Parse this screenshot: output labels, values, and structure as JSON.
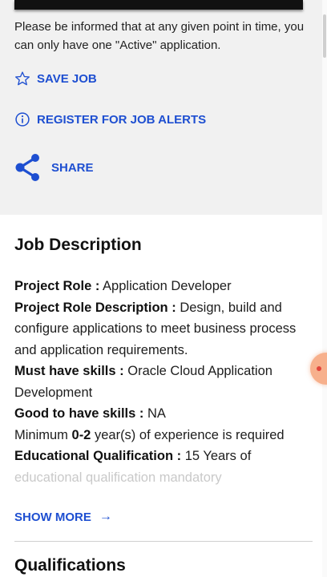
{
  "notice": {
    "text": "Please be informed that at any given point in time, you can only have one \"Active\" application."
  },
  "actions": {
    "save_job": "SAVE JOB",
    "job_alerts": "REGISTER FOR JOB ALERTS",
    "share": "SHARE"
  },
  "job_description": {
    "title": "Job Description",
    "project_role_label": "Project Role :",
    "project_role_value": "Application Developer",
    "role_description_label": "Project Role Description :",
    "role_description_value": "Design, build and configure applications to meet business process and application requirements.",
    "must_have_label": "Must have skills :",
    "must_have_value": "Oracle Cloud Application Development",
    "good_to_have_label": "Good to have skills :",
    "good_to_have_value": "NA",
    "experience_prefix": "Minimum",
    "experience_years": "0-2",
    "experience_suffix": "year(s) of experience is required",
    "education_label": "Educational Qualification :",
    "education_value": "15 Years of",
    "education_faded": "educational qualification mandatory"
  },
  "show_more": {
    "label": "SHOW MORE",
    "arrow": "→"
  },
  "qualifications": {
    "title": "Qualifications"
  },
  "colors": {
    "accent": "#1e4fd1",
    "top_background": "#f1f1f1",
    "chat_bubble": "#f7b08c"
  },
  "icons": {
    "save": "star-outline-icon",
    "alerts": "info-circle-icon",
    "share": "share-icon",
    "show_more": "arrow-right-icon"
  }
}
